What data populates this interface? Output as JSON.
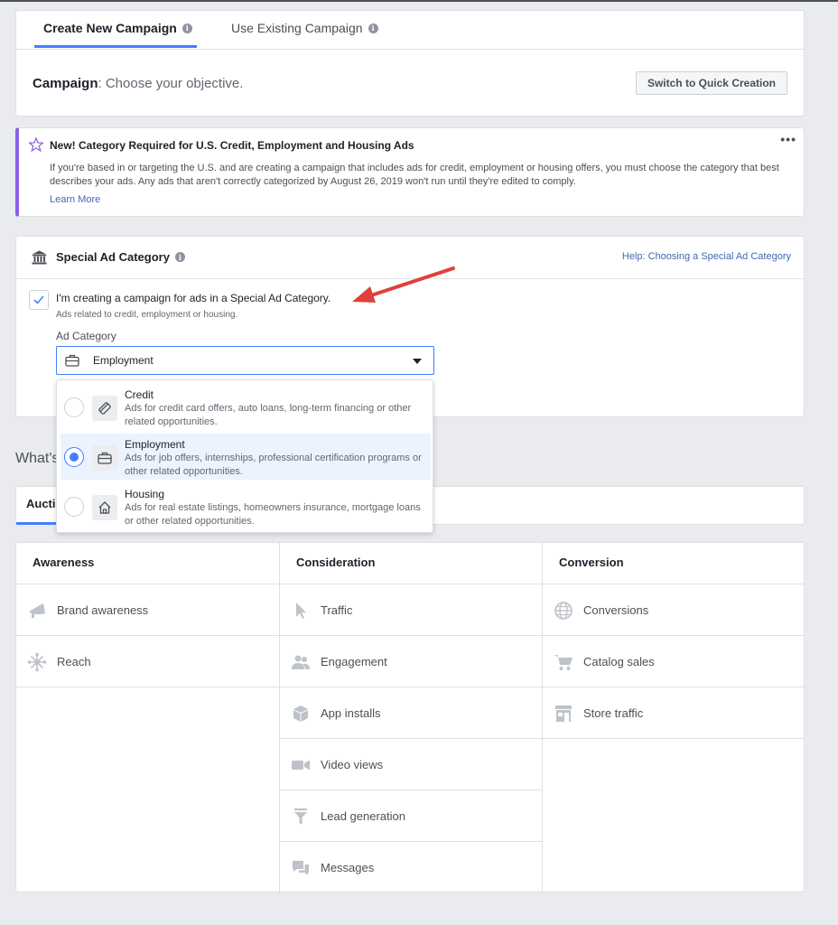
{
  "tabs": {
    "create_new": "Create New Campaign",
    "use_existing": "Use Existing Campaign"
  },
  "campaign": {
    "label": "Campaign",
    "prompt": ": Choose your objective.",
    "quick_button": "Switch to Quick Creation"
  },
  "notice": {
    "title": "New! Category Required for U.S. Credit, Employment and Housing Ads",
    "body": "If you're based in or targeting the U.S. and are creating a campaign that includes ads for credit, employment or housing offers, you must choose the category that best describes your ads. Any ads that aren't correctly categorized by August 26, 2019 won't run until they're edited to comply.",
    "link": "Learn More",
    "menu": "•••",
    "accent_color": "#8b5fe8"
  },
  "special": {
    "title": "Special Ad Category",
    "help_link": "Help: Choosing a Special Ad Category",
    "checkbox_label": "I'm creating a campaign for ads in a Special Ad Category.",
    "checkbox_sub": "Ads related to credit, employment or housing.",
    "checked": true,
    "ad_category_label": "Ad Category",
    "selected_value": "Employment"
  },
  "dropdown": {
    "options": [
      {
        "title": "Credit",
        "desc": "Ads for credit card offers, auto loans, long-term financing or other related opportunities.",
        "icon": "credit-card-icon",
        "selected": false
      },
      {
        "title": "Employment",
        "desc": "Ads for job offers, internships, professional certification programs or other related opportunities.",
        "icon": "briefcase-icon",
        "selected": true
      },
      {
        "title": "Housing",
        "desc": "Ads for real estate listings, homeowners insurance, mortgage loans or other related opportunities.",
        "icon": "house-icon",
        "selected": false
      }
    ]
  },
  "whats": "What's",
  "buying_tab": "Aucti",
  "objectives": {
    "columns": [
      {
        "title": "Awareness",
        "items": [
          {
            "label": "Brand awareness",
            "icon": "megaphone-icon"
          },
          {
            "label": "Reach",
            "icon": "reach-icon"
          }
        ]
      },
      {
        "title": "Consideration",
        "items": [
          {
            "label": "Traffic",
            "icon": "cursor-icon"
          },
          {
            "label": "Engagement",
            "icon": "people-icon"
          },
          {
            "label": "App installs",
            "icon": "box-icon"
          },
          {
            "label": "Video views",
            "icon": "video-camera-icon"
          },
          {
            "label": "Lead generation",
            "icon": "funnel-icon"
          },
          {
            "label": "Messages",
            "icon": "chat-bubbles-icon"
          }
        ]
      },
      {
        "title": "Conversion",
        "items": [
          {
            "label": "Conversions",
            "icon": "globe-icon"
          },
          {
            "label": "Catalog sales",
            "icon": "shopping-cart-icon"
          },
          {
            "label": "Store traffic",
            "icon": "store-icon"
          }
        ]
      }
    ]
  },
  "colors": {
    "accent": "#4080ff",
    "link": "#4267b2",
    "annotation_arrow": "#e0403a"
  }
}
